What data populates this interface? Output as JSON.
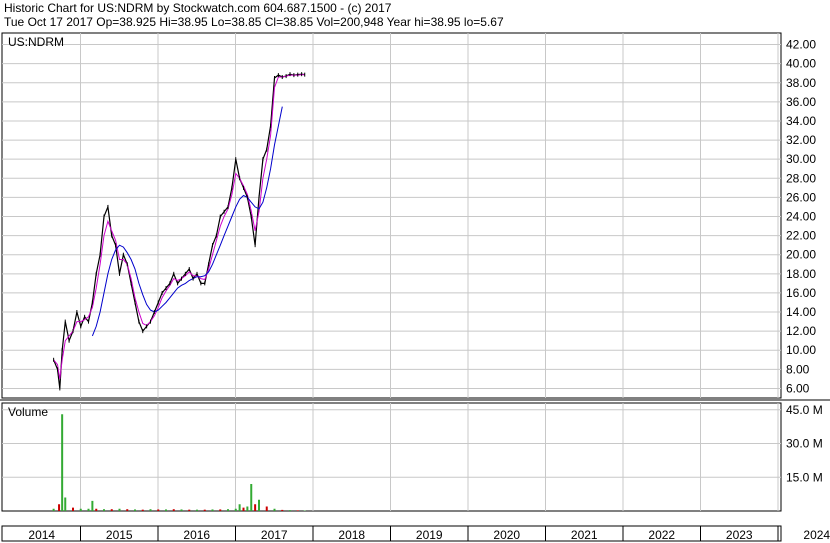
{
  "header": {
    "line1": "Historic Chart for US:NDRM by Stockwatch.com 604.687.1500 - (c) 2017",
    "line2": "Tue Oct 17 2017   Op=38.925   Hi=38.95   Lo=38.85   Cl=38.85   Vol=200,948   Year hi=38.95   lo=5.67"
  },
  "colors": {
    "price": "#000000",
    "ma_short": "#cc00cc",
    "ma_long": "#0000cc",
    "volume_up": "#33aa33",
    "volume_down": "#cc0000",
    "grid": "#c8c8c8"
  },
  "chart_data": [
    {
      "type": "line",
      "title": "US:NDRM",
      "ylim": [
        5,
        43
      ],
      "y_ticks": [
        "6.00",
        "8.00",
        "10.00",
        "12.00",
        "14.00",
        "16.00",
        "18.00",
        "20.00",
        "22.00",
        "24.00",
        "26.00",
        "28.00",
        "30.00",
        "32.00",
        "34.00",
        "36.00",
        "38.00",
        "40.00",
        "42.00"
      ],
      "x_ticks": [
        "2014",
        "2015",
        "2016",
        "2017",
        "2018",
        "2019",
        "2020",
        "2021",
        "2022",
        "2023",
        "2024"
      ],
      "grid": true,
      "x": [
        2014.55,
        2014.6,
        2014.63,
        2014.66,
        2014.7,
        2014.75,
        2014.8,
        2014.85,
        2014.9,
        2014.95,
        2015.0,
        2015.05,
        2015.1,
        2015.15,
        2015.2,
        2015.25,
        2015.3,
        2015.35,
        2015.4,
        2015.45,
        2015.5,
        2015.55,
        2015.6,
        2015.65,
        2015.7,
        2015.75,
        2015.8,
        2015.85,
        2015.9,
        2015.95,
        2016.0,
        2016.05,
        2016.1,
        2016.15,
        2016.2,
        2016.25,
        2016.3,
        2016.35,
        2016.4,
        2016.45,
        2016.5,
        2016.55,
        2016.6,
        2016.65,
        2016.7,
        2016.75,
        2016.8,
        2016.85,
        2016.9,
        2016.95,
        2017.0,
        2017.05,
        2017.1,
        2017.15,
        2017.2,
        2017.25,
        2017.3,
        2017.35,
        2017.4,
        2017.45,
        2017.5,
        2017.55,
        2017.6,
        2017.65,
        2017.7,
        2017.75,
        2017.79
      ],
      "series": [
        {
          "values": [
            9.0,
            8.0,
            6.0,
            10.0,
            13.0,
            11.0,
            12.0,
            14.0,
            12.5,
            13.5,
            13.0,
            15.0,
            18.0,
            20.0,
            24.0,
            25.0,
            22.0,
            21.0,
            18.0,
            20.0,
            19.0,
            17.0,
            15.0,
            13.0,
            12.0,
            12.5,
            13.0,
            14.0,
            15.0,
            16.0,
            16.5,
            17.0,
            18.0,
            17.0,
            17.5,
            18.0,
            18.5,
            17.5,
            18.0,
            17.0,
            17.0,
            19.0,
            21.0,
            22.0,
            24.0,
            24.5,
            25.0,
            27.0,
            30.0,
            28.0,
            27.0,
            26.0,
            24.0,
            21.0,
            26.0,
            30.0,
            31.0,
            33.5,
            38.5,
            38.8,
            38.6,
            38.7,
            38.9,
            38.8,
            38.85,
            38.9,
            38.85
          ]
        },
        {
          "values": [
            9.0,
            8.5,
            7.0,
            9.0,
            11.0,
            11.5,
            12.0,
            13.0,
            13.0,
            13.2,
            13.5,
            14.5,
            16.5,
            19.0,
            22.0,
            23.5,
            22.5,
            21.5,
            19.5,
            19.5,
            19.0,
            17.5,
            15.5,
            14.0,
            12.8,
            12.6,
            13.0,
            13.6,
            14.5,
            15.5,
            16.2,
            16.8,
            17.5,
            17.3,
            17.5,
            17.8,
            18.2,
            17.8,
            17.8,
            17.5,
            17.4,
            18.5,
            20.0,
            21.5,
            23.0,
            24.0,
            24.8,
            26.3,
            28.5,
            28.0,
            27.2,
            26.3,
            24.6,
            22.5,
            24.5,
            28.0,
            30.0,
            32.5,
            37.5,
            38.6,
            38.6,
            38.7,
            38.8,
            38.8,
            38.8,
            38.85,
            38.85
          ]
        },
        {
          "values": [
            null,
            null,
            null,
            null,
            null,
            null,
            null,
            null,
            null,
            null,
            null,
            11.5,
            12.5,
            14.0,
            16.0,
            18.0,
            19.5,
            20.5,
            21.0,
            20.8,
            20.2,
            19.5,
            18.5,
            17.0,
            15.8,
            14.8,
            14.2,
            14.0,
            14.2,
            14.6,
            15.0,
            15.5,
            16.0,
            16.5,
            16.8,
            17.0,
            17.3,
            17.5,
            17.7,
            17.7,
            17.8,
            18.2,
            19.0,
            20.0,
            21.0,
            22.0,
            23.0,
            24.0,
            25.0,
            25.8,
            26.2,
            26.0,
            25.5,
            25.0,
            24.8,
            25.5,
            27.0,
            29.0,
            31.5,
            33.5,
            35.5
          ]
        }
      ]
    },
    {
      "type": "bar",
      "title": "Volume",
      "ylim": [
        0,
        48
      ],
      "y_ticks": [
        "15.0 M",
        "30.0 M",
        "45.0 M"
      ],
      "x": [
        2014.55,
        2014.62,
        2014.66,
        2014.7,
        2014.8,
        2014.9,
        2015.0,
        2015.05,
        2015.1,
        2015.2,
        2015.3,
        2015.4,
        2015.5,
        2015.6,
        2015.7,
        2015.8,
        2015.9,
        2016.0,
        2016.1,
        2016.2,
        2016.3,
        2016.4,
        2016.5,
        2016.6,
        2016.7,
        2016.8,
        2016.9,
        2016.95,
        2017.0,
        2017.05,
        2017.1,
        2017.15,
        2017.2,
        2017.3,
        2017.4,
        2017.5,
        2017.6,
        2017.7,
        2017.79
      ],
      "values": [
        1.0,
        3.0,
        43.0,
        6.0,
        1.5,
        1.0,
        1.0,
        4.5,
        1.0,
        0.8,
        0.8,
        1.0,
        0.8,
        0.7,
        0.6,
        0.8,
        0.7,
        0.7,
        0.8,
        0.7,
        0.6,
        0.6,
        0.6,
        0.7,
        0.7,
        0.8,
        1.0,
        3.0,
        1.5,
        2.0,
        12.0,
        3.0,
        5.0,
        2.0,
        1.0,
        0.5,
        0.4,
        0.3,
        0.2
      ],
      "up": [
        true,
        false,
        true,
        true,
        false,
        true,
        true,
        true,
        false,
        true,
        false,
        true,
        false,
        true,
        false,
        true,
        false,
        true,
        false,
        true,
        false,
        true,
        false,
        true,
        false,
        true,
        true,
        true,
        false,
        true,
        true,
        false,
        true,
        false,
        true,
        false,
        true,
        false,
        true
      ]
    }
  ]
}
